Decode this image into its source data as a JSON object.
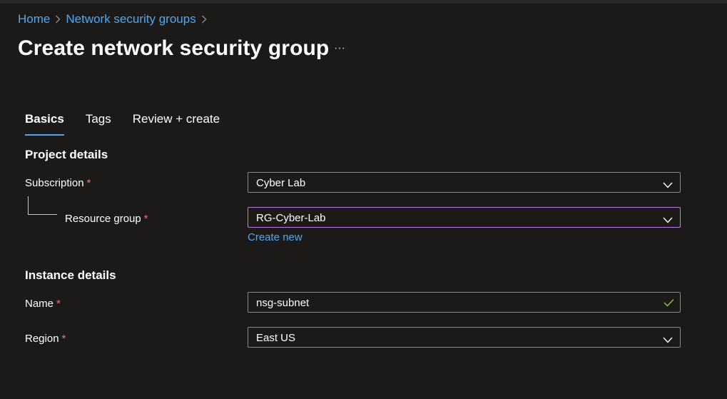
{
  "breadcrumb": {
    "home": "Home",
    "nsg": "Network security groups"
  },
  "page": {
    "title": "Create network security group",
    "more": "···"
  },
  "tabs": [
    {
      "label": "Basics",
      "active": true
    },
    {
      "label": "Tags",
      "active": false
    },
    {
      "label": "Review + create",
      "active": false
    }
  ],
  "project": {
    "title": "Project details",
    "subscription_label": "Subscription",
    "subscription_value": "Cyber Lab",
    "resource_group_label": "Resource group",
    "resource_group_value": "RG-Cyber-Lab",
    "create_new": "Create new"
  },
  "instance": {
    "title": "Instance details",
    "name_label": "Name",
    "name_value": "nsg-subnet",
    "region_label": "Region",
    "region_value": "East US"
  },
  "required_marker": "*",
  "colors": {
    "background": "#1b1a19",
    "link": "#4fa8f0",
    "required": "#f1707b",
    "focus_border": "#c27ce8",
    "valid_check": "#92c353"
  }
}
